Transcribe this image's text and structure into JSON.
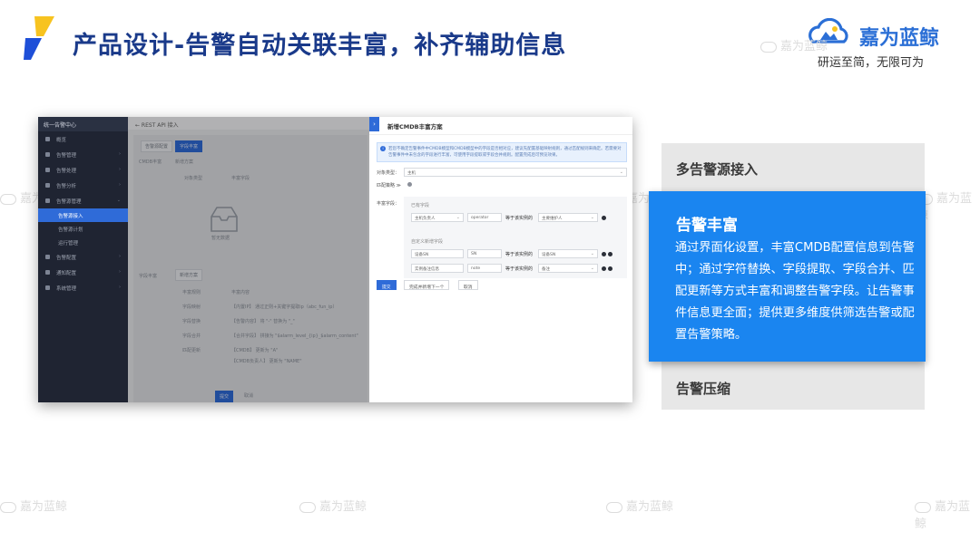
{
  "header": {
    "title": "产品设计-告警自动关联丰富，补齐辅助信息",
    "brand_name": "嘉为蓝鲸",
    "slogan": "研运至简，无限可为"
  },
  "watermark": "嘉为蓝鲸",
  "screenshot": {
    "sidebar": {
      "header": "统一告警中心",
      "items": [
        {
          "label": "概览"
        },
        {
          "label": "告警管理"
        },
        {
          "label": "告警处理"
        },
        {
          "label": "告警分析"
        },
        {
          "label": "告警源管理"
        }
      ],
      "sub_items": [
        "告警源接入",
        "告警源计划",
        "运行管理"
      ],
      "items_bottom": [
        {
          "label": "告警配置"
        },
        {
          "label": "通知配置"
        },
        {
          "label": "系统管理"
        }
      ]
    },
    "main": {
      "breadcrumb": "← REST API 接入",
      "tabs": [
        "告警源配置",
        "字段丰富"
      ],
      "cmdb_label": "CMDB丰富",
      "add_button": "新增方案",
      "col_object": "对象类型",
      "col_strategy": "丰富字段",
      "empty_text": "暂无数据",
      "rich_label": "字段丰富",
      "rich_add": "新增方案",
      "rows": [
        {
          "k": "丰富规则",
          "v": "丰富内容"
        },
        {
          "k": "字段映射",
          "v": "【内置IP】 通过正则+关键字提取ip（abc_fun_ip）"
        },
        {
          "k": "字段替换",
          "v": "【告警内容】 将 \"-\" 替换为 \"_\""
        },
        {
          "k": "字段合并",
          "v": "【合并字段】 拼接为 \"$alarm_level_{ip}_$alarm_content\""
        },
        {
          "k": "匹配更新",
          "v": "【CMDB】 更新为 \"A\""
        },
        {
          "k": "",
          "v": "【CMDB负责人】 更新为 \"NAME\""
        }
      ],
      "submit": "提交",
      "cancel": "取消"
    },
    "drawer": {
      "title": "新增CMDB丰富方案",
      "tip": "若您不确定告警事件中CMDB模型和CMDB模型中的字段是否相对应，建议先配置基础映射规则，通过匹配规则来确定。若需要对告警事件中未包含的字段进行丰富，可使用字段提取或字段合并规则。配置完成后可预览效果。",
      "object_type_label": "对象类型：",
      "object_type_value": "主机",
      "match_label": "匹配策略 ≫",
      "rich_field_label": "丰富字段：",
      "fixed_field_title": "已有字段",
      "fixed_row": {
        "a": "主机负责人",
        "b": "operator",
        "eq": "等于该实例的",
        "c": "主要维护人"
      },
      "custom_title": "自定义新增字段",
      "custom_rows": [
        {
          "a": "设备SN",
          "b": "SN",
          "eq": "等于该实例的",
          "c": "设备SN"
        },
        {
          "a": "实例备注信息",
          "b": "note",
          "eq": "等于该实例的",
          "c": "备注"
        }
      ],
      "btn_submit": "提交",
      "btn_continue": "完成并新增下一个",
      "btn_cancel": "取消"
    }
  },
  "panels": {
    "top": "多告警源接入",
    "middle_title": "告警丰富",
    "middle_body": "通过界面化设置，丰富CMDB配置信息到告警中；通过字符替换、字段提取、字段合并、匹配更新等方式丰富和调整告警字段。让告警事件信息更全面；提供更多维度供筛选告警或配置告警策略。",
    "bottom": "告警压缩"
  },
  "colors": {
    "title": "#1a3a8a",
    "accent_blue": "#1a85f0",
    "panel_gray": "#e7e7e7",
    "logo_yellow": "#f7c320",
    "logo_blue": "#1e4fd8"
  }
}
